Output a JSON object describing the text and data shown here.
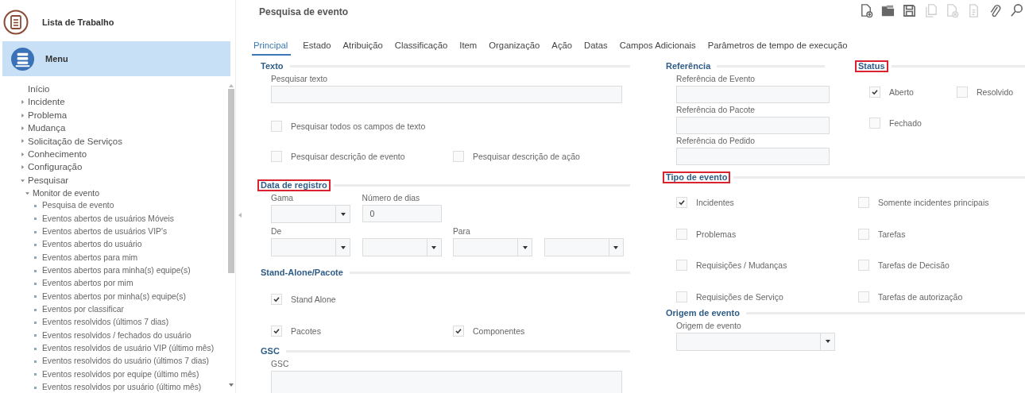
{
  "sidebar": {
    "worklist": "Lista de Trabalho",
    "menu": {
      "label": "Menu",
      "selected": true
    },
    "items": [
      {
        "label": "Início"
      },
      {
        "label": "Incidente",
        "expanded": false
      },
      {
        "label": "Problema",
        "expanded": false
      },
      {
        "label": "Mudança",
        "expanded": false
      },
      {
        "label": "Solicitação de Serviços",
        "expanded": false
      },
      {
        "label": "Conhecimento",
        "expanded": false
      },
      {
        "label": "Configuração",
        "expanded": false
      },
      {
        "label": "Pesquisar",
        "expanded": true,
        "children": [
          {
            "label": "Monitor de evento",
            "expanded": true,
            "children": [
              {
                "label": "Pesquisa de evento"
              },
              {
                "label": "Eventos abertos de usuários Móveis"
              },
              {
                "label": "Eventos abertos de usuários VIP's"
              },
              {
                "label": "Eventos abertos do usuário"
              },
              {
                "label": "Eventos abertos para mim"
              },
              {
                "label": "Eventos abertos para minha(s) equipe(s)"
              },
              {
                "label": "Eventos abertos por mim"
              },
              {
                "label": "Eventos abertos por minha(s) equipe(s)"
              },
              {
                "label": "Eventos por classificar"
              },
              {
                "label": "Eventos resolvidos (últimos 7 dias)"
              },
              {
                "label": "Eventos resolvidos / fechados do usuário"
              },
              {
                "label": "Eventos resolvidos de usuário VIP (último mês)"
              },
              {
                "label": "Eventos resolvidos do usuário (últimos 7 dias)"
              },
              {
                "label": "Eventos resolvidos por equipe (último mês)"
              },
              {
                "label": "Eventos resolvidos por usuário (último mês)"
              }
            ]
          }
        ]
      }
    ]
  },
  "title": "Pesquisa de evento",
  "toolbar": [
    {
      "kind": "new",
      "disabled": false
    },
    {
      "kind": "open",
      "disabled": false
    },
    {
      "kind": "save",
      "disabled": false
    },
    {
      "kind": "copy",
      "disabled": true
    },
    {
      "kind": "delete",
      "disabled": true
    },
    {
      "kind": "document",
      "disabled": true
    },
    {
      "kind": "attach",
      "disabled": false
    },
    {
      "kind": "search",
      "disabled": false
    }
  ],
  "tabs": [
    {
      "label": "Principal",
      "selected": true
    },
    {
      "label": "Estado",
      "selected": false
    },
    {
      "label": "Atribuição",
      "selected": false
    },
    {
      "label": "Classificação",
      "selected": false
    },
    {
      "label": "Item",
      "selected": false
    },
    {
      "label": "Organização",
      "selected": false
    },
    {
      "label": "Ação",
      "selected": false
    },
    {
      "label": "Datas",
      "selected": false
    },
    {
      "label": "Campos Adicionais",
      "selected": false
    },
    {
      "label": "Parâmetros de tempo de execução",
      "selected": false
    }
  ],
  "texto": {
    "title": "Texto",
    "highlighted": false,
    "search_label": "Pesquisar texto",
    "all_fields": {
      "label": "Pesquisar todos os campos de texto",
      "checked": false
    },
    "event_description": {
      "label": "Pesquisar descrição de evento",
      "checked": false
    },
    "action_description": {
      "label": "Pesquisar descrição de ação",
      "checked": false
    }
  },
  "data_registro": {
    "title": "Data de registro",
    "highlighted": true,
    "range_label": "Gama",
    "days_label": "Número de dias",
    "days_value": "0",
    "from_label": "De",
    "to_label": "Para"
  },
  "stand_alone": {
    "title": "Stand-Alone/Pacote",
    "highlighted": false,
    "stand_alone": {
      "label": "Stand Alone",
      "checked": true
    },
    "packages": {
      "label": "Pacotes",
      "checked": true
    },
    "components": {
      "label": "Componentes",
      "checked": true
    }
  },
  "gsc": {
    "title": "GSC",
    "highlighted": false,
    "label": "GSC"
  },
  "referencia": {
    "title": "Referência",
    "highlighted": false,
    "fields": [
      {
        "label": "Referência de Evento"
      },
      {
        "label": "Referência do Pacote"
      },
      {
        "label": "Referência do Pedido"
      }
    ]
  },
  "status": {
    "title": "Status",
    "highlighted": true,
    "options": [
      {
        "label": "Aberto",
        "checked": true
      },
      {
        "label": "Resolvido",
        "checked": false
      },
      {
        "label": "Fechado",
        "checked": false
      }
    ]
  },
  "tipo_evento": {
    "title": "Tipo de evento",
    "highlighted": true,
    "options": [
      {
        "label": "Incidentes",
        "checked": true
      },
      {
        "label": "Somente incidentes principais",
        "checked": false
      },
      {
        "label": "Problemas",
        "checked": false
      },
      {
        "label": "Tarefas",
        "checked": false
      },
      {
        "label": "Requisições / Mudanças",
        "checked": false
      },
      {
        "label": "Tarefas de Decisão",
        "checked": false
      },
      {
        "label": "Requisições de Serviço",
        "checked": false
      },
      {
        "label": "Tarefas de autorização",
        "checked": false
      }
    ]
  },
  "origem": {
    "title": "Origem de evento",
    "highlighted": false,
    "label": "Origem de evento"
  }
}
